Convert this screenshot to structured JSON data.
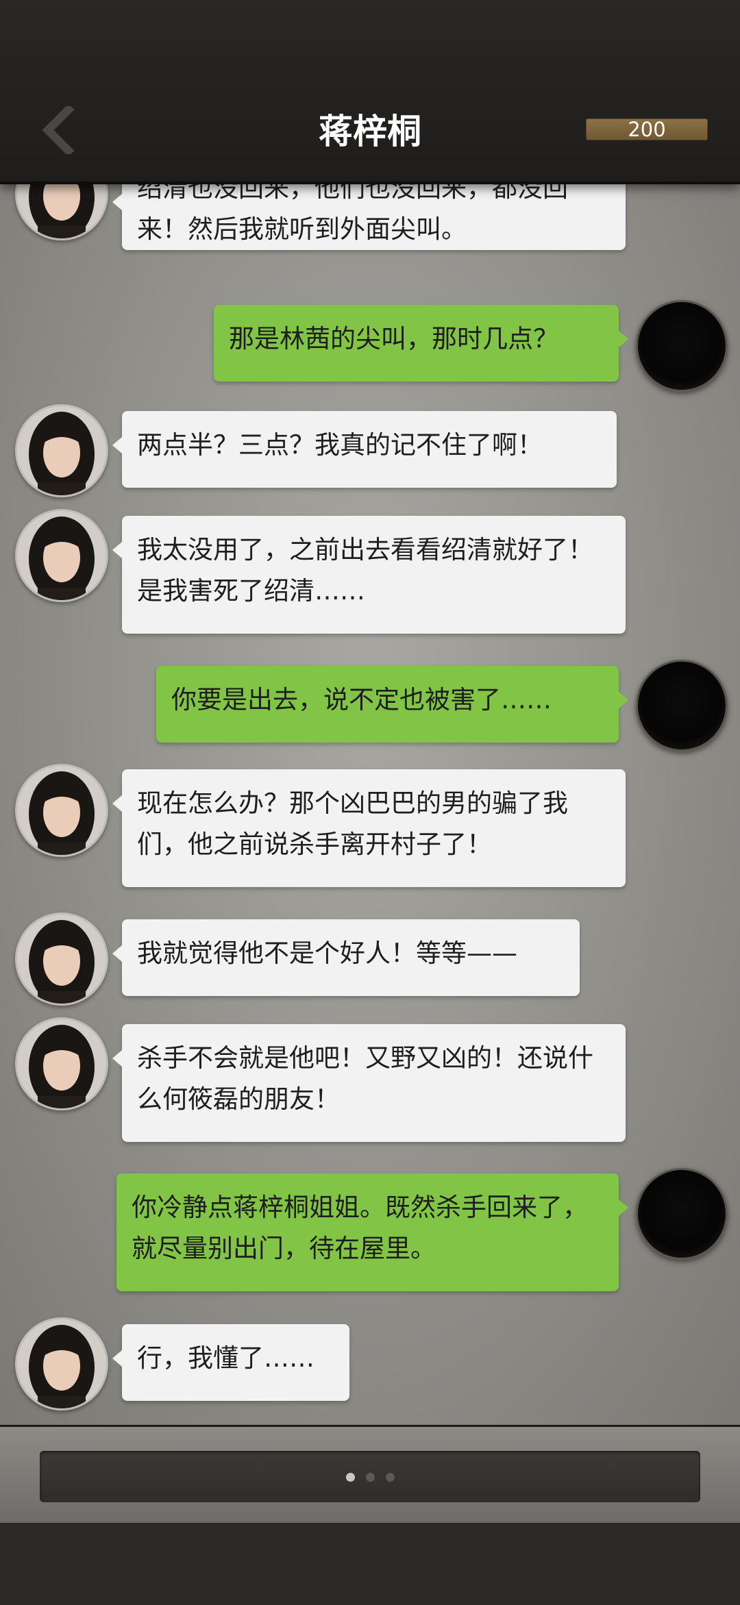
{
  "header": {
    "title": "蒋梓桐",
    "coins": "200",
    "back_icon": "chevron-left-icon"
  },
  "messages": [
    {
      "side": "left",
      "text": "绍清也没回来，他们也没回来，都没回来！然后我就听到外面尖叫。"
    },
    {
      "side": "right",
      "text": "那是林茜的尖叫，那时几点？"
    },
    {
      "side": "left",
      "text": "两点半？三点？我真的记不住了啊！"
    },
    {
      "side": "left",
      "text": "我太没用了，之前出去看看绍清就好了！是我害死了绍清……"
    },
    {
      "side": "right",
      "text": "你要是出去，说不定也被害了……"
    },
    {
      "side": "left",
      "text": "现在怎么办？那个凶巴巴的男的骗了我们，他之前说杀手离开村子了！"
    },
    {
      "side": "left",
      "text": "我就觉得他不是个好人！等等——"
    },
    {
      "side": "left",
      "text": "杀手不会就是他吧！又野又凶的！还说什么何筱磊的朋友！"
    },
    {
      "side": "right",
      "text": "你冷静点蒋梓桐姐姐。既然杀手回来了，就尽量别出门，待在屋里。"
    },
    {
      "side": "left",
      "text": "行，我懂了……"
    }
  ],
  "footer": {
    "page_dots": 3,
    "active_dot": 1
  },
  "colors": {
    "left_bubble": "#f2f2f2",
    "right_bubble": "#82c546",
    "header_bg": "#231f1d",
    "coins_bg": "#7d6540"
  }
}
